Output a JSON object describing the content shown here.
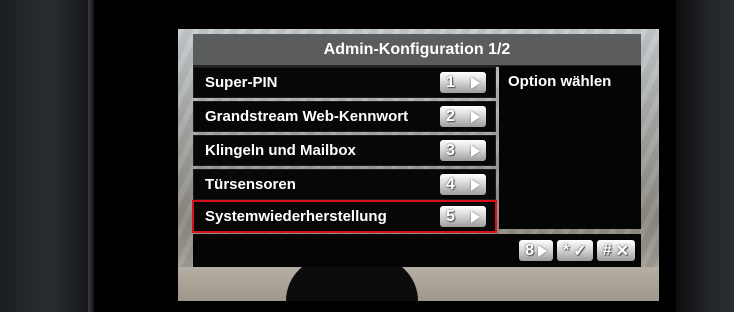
{
  "title": "Admin-Konfiguration 1/2",
  "menu": [
    {
      "label": "Super-PIN",
      "key": "1"
    },
    {
      "label": "Grandstream Web-Kennwort",
      "key": "2"
    },
    {
      "label": "Klingeln und Mailbox",
      "key": "3"
    },
    {
      "label": "Türsensoren",
      "key": "4"
    },
    {
      "label": "Systemwiederherstellung",
      "key": "5",
      "selected": true
    }
  ],
  "hint": "Option wählen",
  "softkeys": {
    "next_key": "8",
    "confirm_key": "*",
    "cancel_key": "#"
  },
  "colors": {
    "selection": "#d8101c",
    "titlebar": "#5a5c5e",
    "panel": "#070707"
  }
}
